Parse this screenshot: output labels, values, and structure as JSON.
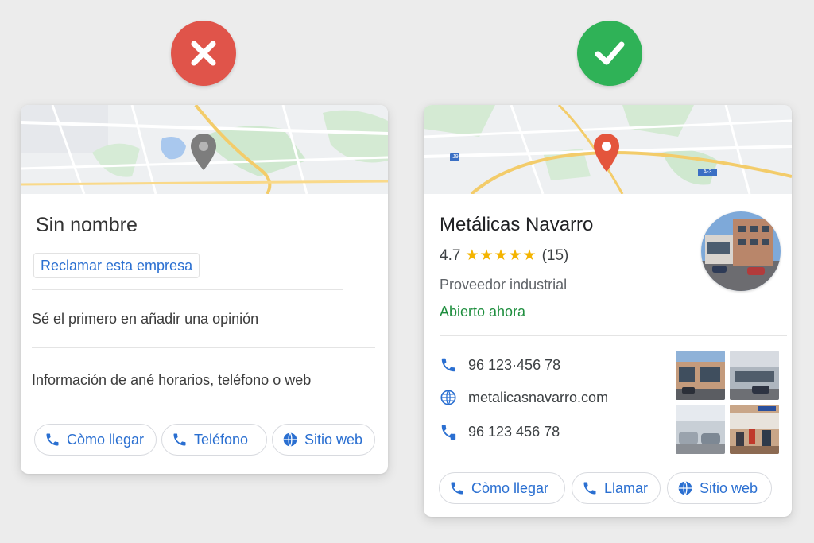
{
  "left_card": {
    "title": "Sin nombre",
    "claim_link": "Reclamar esta empresa",
    "review_prompt": "Sé el primero en añadir una opinión",
    "info_prompt": "Información de ané horarios, teléfono o web",
    "buttons": [
      {
        "label": "Còmo llegar",
        "icon": "phone-icon"
      },
      {
        "label": "Teléfono",
        "icon": "phone-icon"
      },
      {
        "label": "Sitio web",
        "icon": "globe-icon"
      }
    ]
  },
  "right_card": {
    "title": "Metálicas Navarro",
    "rating": "4.7",
    "stars": "★★★★★",
    "review_count": "(15)",
    "category": "Proveedor industrial",
    "status": "Abierto ahora",
    "map_labels": [
      "J9",
      "A-3"
    ],
    "contact": [
      {
        "icon": "phone-icon",
        "text": "96 123·456 78"
      },
      {
        "icon": "globe-icon",
        "text": "metalicasnavarro.com"
      },
      {
        "icon": "mobile-phone-icon",
        "text": "96 123 456 78"
      }
    ],
    "buttons": [
      {
        "label": "Còmo llegar",
        "icon": "phone-icon"
      },
      {
        "label": "Llamar",
        "icon": "phone-icon"
      },
      {
        "label": "Sitio web",
        "icon": "globe-icon"
      }
    ]
  },
  "colors": {
    "bad": "#e0544a",
    "good": "#2fb257",
    "link_blue": "#2a6fd1",
    "open_green": "#1e8e3e",
    "star": "#f4b400",
    "pin_gray": "#7d7d7d",
    "pin_red": "#e4553c"
  }
}
